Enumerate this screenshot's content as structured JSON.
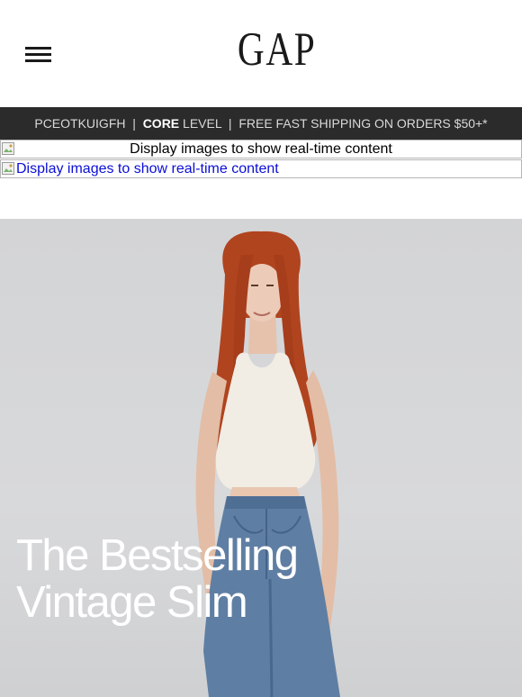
{
  "header": {
    "brand": "GAP",
    "menu_icon": "hamburger-menu-icon"
  },
  "promo_bar": {
    "code": "PCEOTKUIGFH",
    "separator": "|",
    "level_bold": "CORE",
    "level_suffix": "LEVEL",
    "shipping": "FREE FAST SHIPPING ON ORDERS $50+*"
  },
  "image_placeholders": [
    {
      "alt": "Display images to show real-time content"
    },
    {
      "alt": "Display images to show real-time content"
    }
  ],
  "hero": {
    "line1": "The Bestselling",
    "line2": "Vintage Slim"
  },
  "colors": {
    "promo_bg": "#2b2b2b",
    "hero_bg": "#d5d6d8",
    "link_blue": "#0b0ed6",
    "hair": "#b0441f",
    "denim": "#5f7ea3"
  }
}
